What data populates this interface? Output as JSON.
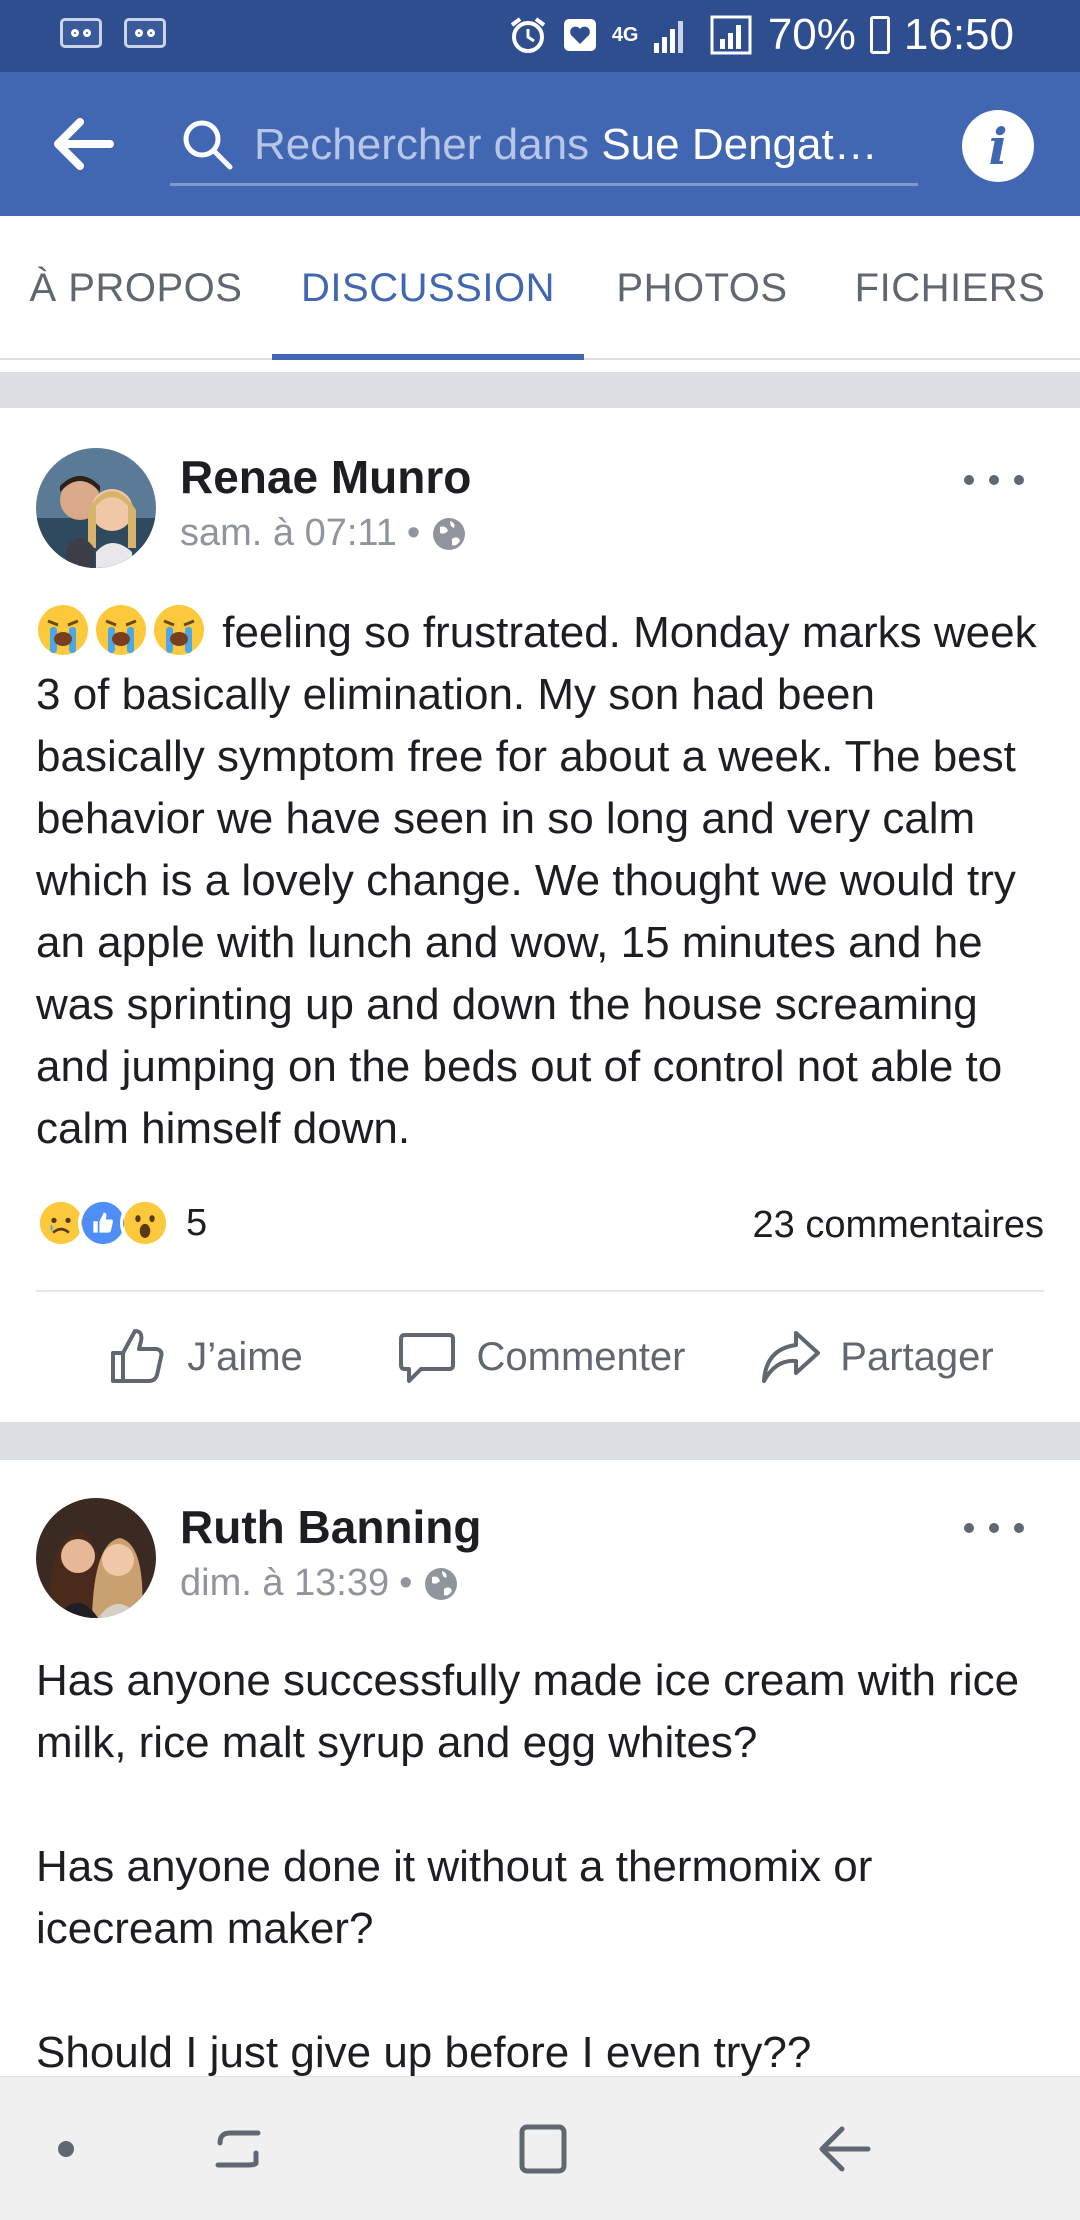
{
  "status_bar": {
    "network": "4G",
    "battery": "70%",
    "time": "16:50"
  },
  "search": {
    "placeholder": "Rechercher dans",
    "group": "Sue Dengat…"
  },
  "tabs": [
    {
      "label": "À PROPOS",
      "active": false
    },
    {
      "label": "DISCUSSION",
      "active": true
    },
    {
      "label": "PHOTOS",
      "active": false
    },
    {
      "label": "FICHIERS",
      "active": false
    }
  ],
  "posts": [
    {
      "author": "Renae Munro",
      "time": "sam. à 07:11",
      "emojis": [
        "crying-face",
        "crying-face",
        "crying-face"
      ],
      "text": "feeling so frustrated. Monday marks week 3 of basically elimination. My son had been basically symptom free for about a week. The best behavior we have seen in so long and very calm which is a lovely change. We thought we would try an apple with lunch and wow, 15 minutes and he was sprinting up and down the house screaming and jumping on the beds out of control not able to calm himself down.",
      "reactions": [
        "sad",
        "like",
        "wow"
      ],
      "reaction_count": "5",
      "comment_count": "23 commentaires"
    },
    {
      "author": "Ruth Banning",
      "time": "dim. à 13:39",
      "paragraphs": [
        "Has anyone successfully made ice cream with rice milk, rice malt syrup and egg whites?",
        "Has anyone done it without a thermomix or icecream maker?",
        "Should I just give up before I even try??"
      ]
    }
  ],
  "actions": {
    "like": "J’aime",
    "comment": "Commenter",
    "share": "Partager"
  },
  "colors": {
    "header": "#4267b2",
    "status_bar": "#2f4e8f",
    "accent": "#4267b2"
  }
}
